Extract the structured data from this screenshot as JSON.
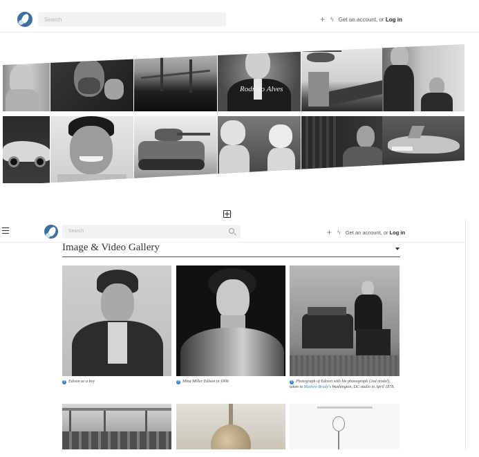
{
  "header": {
    "search_placeholder": "Search",
    "account_prefix": "Get an account, or",
    "login_label": "Log in"
  },
  "mosaic": {
    "caption_text": "Rodrigo Alves",
    "tiles": [
      {
        "name": "tile-statue",
        "subject": "statue"
      },
      {
        "name": "tile-bearded-man",
        "subject": "portrait"
      },
      {
        "name": "tile-bridge",
        "subject": "bridge at night"
      },
      {
        "name": "tile-suited-man",
        "subject": "portrait"
      },
      {
        "name": "tile-helicopter",
        "subject": "helicopter"
      },
      {
        "name": "tile-actors",
        "subject": "two people"
      },
      {
        "name": "tile-sports-car",
        "subject": "car"
      },
      {
        "name": "tile-smiling-man",
        "subject": "portrait"
      },
      {
        "name": "tile-tank",
        "subject": "tank"
      },
      {
        "name": "tile-stormtroopers",
        "subject": "costumes"
      },
      {
        "name": "tile-thinking-man",
        "subject": "portrait"
      },
      {
        "name": "tile-shark",
        "subject": "shark"
      }
    ]
  },
  "page2": {
    "search_placeholder": "Search",
    "account_prefix": "Get an account, or",
    "login_label": "Log in",
    "gallery_title": "Image & Video Gallery",
    "captions": [
      {
        "text": "Edison as a boy"
      },
      {
        "text": "Mina Miller Edison in 1906"
      },
      {
        "pre": "Photograph of Edison with his phonograph (2nd model), taken in ",
        "link": "Mathew Brady",
        "post": "'s Washington, DC studio in April 1878."
      }
    ]
  },
  "colors": {
    "accent": "#3b7fc4",
    "logo": "#3d6f9e",
    "search_bg": "#f2f2f2"
  }
}
